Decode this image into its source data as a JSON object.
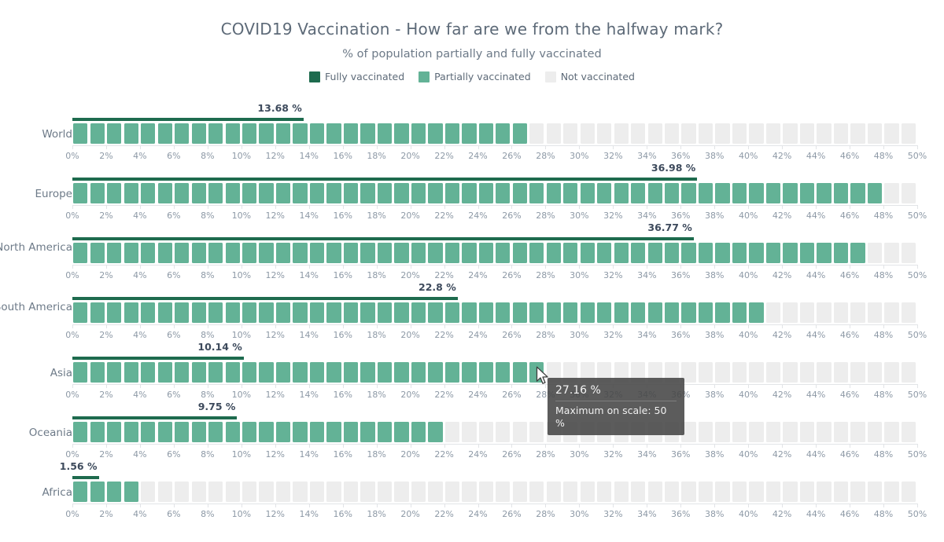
{
  "header": {
    "title": "COVID19 Vaccination - How far are we from the halfway mark?",
    "subtitle": "% of population partially and fully vaccinated"
  },
  "legend": {
    "items": [
      {
        "label": "Fully vaccinated",
        "color": "#1e6b4e"
      },
      {
        "label": "Partially vaccinated",
        "color": "#63b296"
      },
      {
        "label": "Not vaccinated",
        "color": "#ededed"
      }
    ]
  },
  "tooltip": {
    "value": "27.16 %",
    "note": "Maximum on scale: 50 %"
  },
  "axis": {
    "tick_labels": [
      "0%",
      "2%",
      "4%",
      "6%",
      "8%",
      "10%",
      "12%",
      "14%",
      "16%",
      "18%",
      "20%",
      "22%",
      "24%",
      "26%",
      "28%",
      "30%",
      "32%",
      "34%",
      "36%",
      "38%",
      "40%",
      "42%",
      "44%",
      "46%",
      "48%",
      "50%"
    ]
  },
  "chart_data": {
    "type": "bar",
    "title": "COVID19 Vaccination - How far are we from the halfway mark?",
    "subtitle": "% of population partially and fully vaccinated",
    "xlabel": "",
    "ylabel": "",
    "xlim": [
      0,
      50
    ],
    "x_tick_step": 2,
    "x_unit": "%",
    "grid": false,
    "legend_position": "top",
    "segment_step": 1,
    "max_on_scale": 50,
    "categories": [
      "World",
      "Europe",
      "North America",
      "South America",
      "Asia",
      "Oceania",
      "Africa"
    ],
    "series": [
      {
        "name": "Fully vaccinated",
        "color": "#1e6b4e",
        "values": [
          13.68,
          36.98,
          36.77,
          22.8,
          10.14,
          9.75,
          1.56
        ]
      },
      {
        "name": "Partially vaccinated",
        "color": "#63b296",
        "values": [
          27.0,
          48.0,
          47.0,
          41.0,
          28.0,
          22.0,
          4.0
        ]
      }
    ],
    "value_labels": [
      "13.68 %",
      "36.98 %",
      "36.77 %",
      "22.8 %",
      "10.14 %",
      "9.75 %",
      "1.56 %"
    ],
    "rows": [
      {
        "label": "World",
        "fully": 13.68,
        "partial": 27.0,
        "value_label": "13.68 %"
      },
      {
        "label": "Europe",
        "fully": 36.98,
        "partial": 48.0,
        "value_label": "36.98 %"
      },
      {
        "label": "North America",
        "fully": 36.77,
        "partial": 47.0,
        "value_label": "36.77 %"
      },
      {
        "label": "South America",
        "fully": 22.8,
        "partial": 41.0,
        "value_label": "22.8 %"
      },
      {
        "label": "Asia",
        "fully": 10.14,
        "partial": 28.0,
        "value_label": "10.14 %"
      },
      {
        "label": "Oceania",
        "fully": 9.75,
        "partial": 22.0,
        "value_label": "9.75 %"
      },
      {
        "label": "Africa",
        "fully": 1.56,
        "partial": 4.0,
        "value_label": "1.56 %"
      }
    ]
  }
}
